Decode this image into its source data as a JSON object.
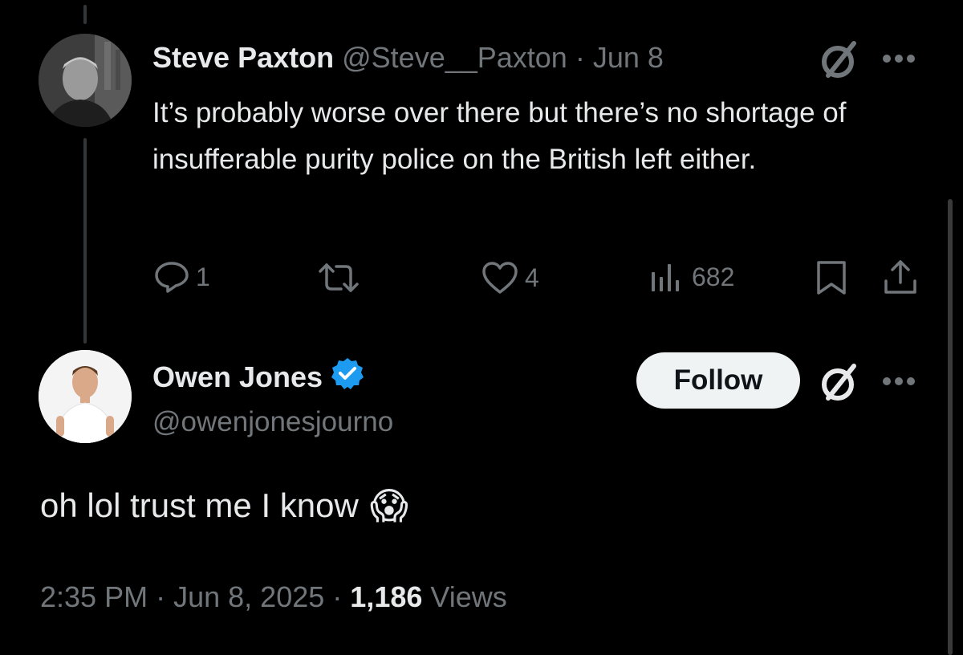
{
  "parent_tweet": {
    "author_name": "Steve Paxton",
    "handle": "@Steve__Paxton",
    "separator": "·",
    "date": "Jun 8",
    "text": "It’s probably worse over there but there’s no shortage of insufferable purity police on the British left either.",
    "actions": {
      "reply_count": "1",
      "like_count": "4",
      "views_count": "682"
    }
  },
  "main_tweet": {
    "author_name": "Owen Jones",
    "handle": "@owenjonesjourno",
    "verified": true,
    "follow_label": "Follow",
    "text": "oh lol trust me I know",
    "emoji": "😱",
    "time": "2:35 PM",
    "sep1": "·",
    "date": "Jun 8, 2025",
    "sep2": "·",
    "views_count": "1,186",
    "views_label": "Views"
  },
  "colors": {
    "background": "#000000",
    "text": "#e7e9ea",
    "muted": "#71767b",
    "verified_badge": "#1d9bf0",
    "follow_button_bg": "#eff3f4",
    "thread_line": "#333639"
  },
  "icons": [
    "reply-icon",
    "retweet-icon",
    "like-icon",
    "views-icon",
    "bookmark-icon",
    "share-icon",
    "grok-icon",
    "more-icon",
    "verified-badge-icon"
  ]
}
